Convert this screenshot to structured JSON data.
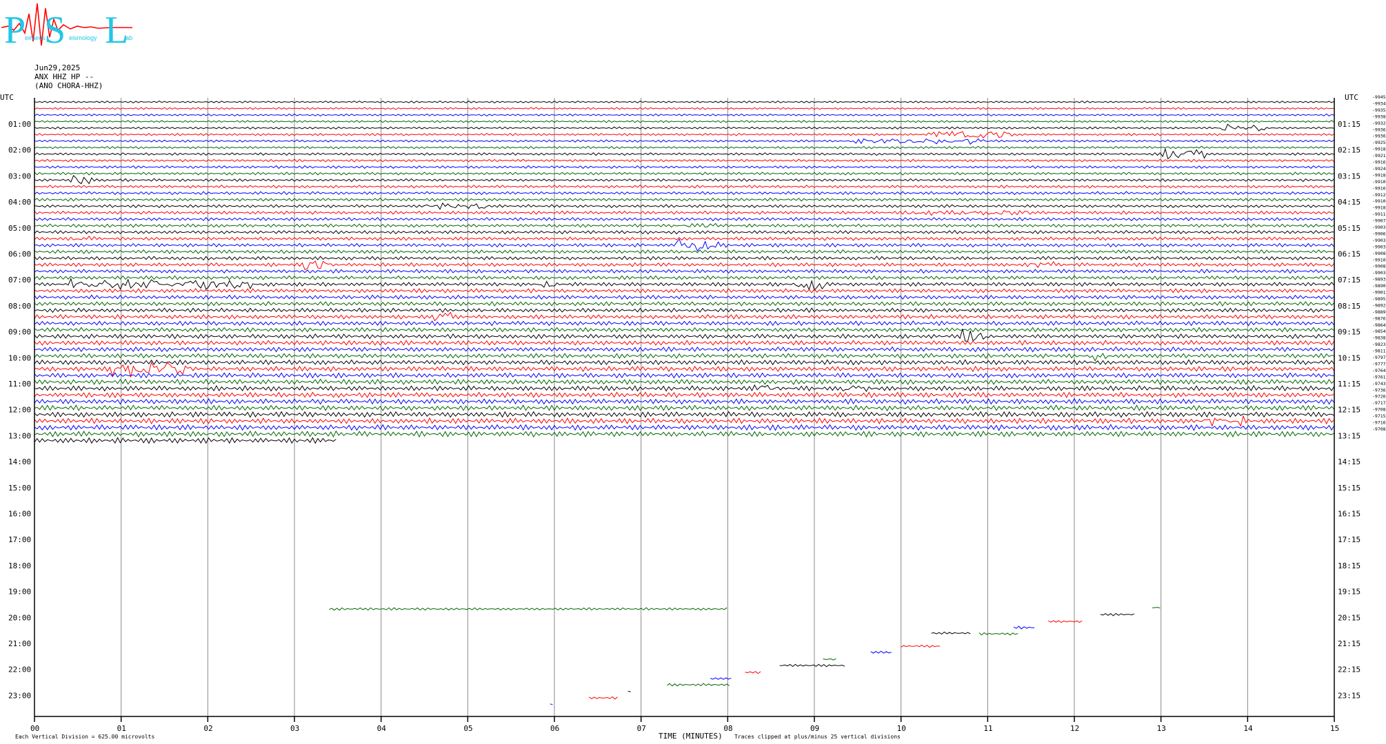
{
  "logo": {
    "big_letters": [
      "P",
      "S",
      "L"
    ],
    "small_text": [
      "eiraeus",
      "eismology",
      "ab"
    ],
    "colors": {
      "text": "#22c6e6",
      "wave": "#ff0000"
    }
  },
  "header": {
    "date": "Jun29,2025",
    "station": "ANX HHZ HP --",
    "label": "(ANO CHORA-HHZ)"
  },
  "axes": {
    "left_title": "UTC",
    "right_title": "UTC",
    "left_hours": [
      "01:00",
      "02:00",
      "03:00",
      "04:00",
      "05:00",
      "06:00",
      "07:00",
      "08:00",
      "09:00",
      "10:00",
      "11:00",
      "12:00",
      "13:00",
      "14:00",
      "15:00",
      "16:00",
      "17:00",
      "18:00",
      "19:00",
      "20:00",
      "21:00",
      "22:00",
      "23:00"
    ],
    "right_hours": [
      "01:15",
      "02:15",
      "03:15",
      "04:15",
      "05:15",
      "06:15",
      "07:15",
      "08:15",
      "09:15",
      "10:15",
      "11:15",
      "12:15",
      "13:15",
      "14:15",
      "15:15",
      "16:15",
      "17:15",
      "18:15",
      "19:15",
      "20:15",
      "21:15",
      "22:15",
      "23:15"
    ],
    "minute_ticks": [
      "00",
      "01",
      "02",
      "03",
      "04",
      "05",
      "06",
      "07",
      "08",
      "09",
      "10",
      "11",
      "12",
      "13",
      "14",
      "15"
    ],
    "x_title": "TIME (MINUTES)"
  },
  "footer": {
    "scale": "Each Vertical Division =  625.00 microvolts",
    "clip": "Traces clipped at plus/minus 25 vertical divisions"
  },
  "chart_data": {
    "type": "line",
    "title": "",
    "xlabel": "TIME (MINUTES)",
    "ylabel": "UTC",
    "xlim": [
      0,
      15
    ],
    "trace_minutes": 15,
    "trace_colors": [
      "#000000",
      "#ff0000",
      "#0000ff",
      "#006400"
    ],
    "data_ends_at": "13:03",
    "right_values": [
      "-9945",
      "-9934",
      "-9935",
      "-9938",
      "-9932",
      "-9936",
      "-9936",
      "-9925",
      "-9918",
      "-9921",
      "-9916",
      "-9924",
      "-9918",
      "-9910",
      "-9916",
      "-9912",
      "-9910",
      "-9918",
      "-9911",
      "-9907",
      "-9903",
      "-9906",
      "-9903",
      "-9903",
      "-9908",
      "-9910",
      "-9908",
      "-9903",
      "-9893",
      "-9890",
      "-9901",
      "-9895",
      "-9892",
      "-9889",
      "-9876",
      "-9864",
      "-9854",
      "-9838",
      "-9823",
      "-9811",
      "-9797",
      "-9777",
      "-9764",
      "-9761",
      "-9743",
      "-9736",
      "-9726",
      "-9717",
      "-9708",
      "-9715",
      "-9716",
      "-9708"
    ],
    "series": [
      {
        "name": "20:00 (trace fragment)",
        "x": [
          3.4,
          8.0
        ]
      },
      {
        "name": "20:15 (trace fragment)",
        "x": [
          8.0,
          12.9
        ]
      }
    ]
  }
}
